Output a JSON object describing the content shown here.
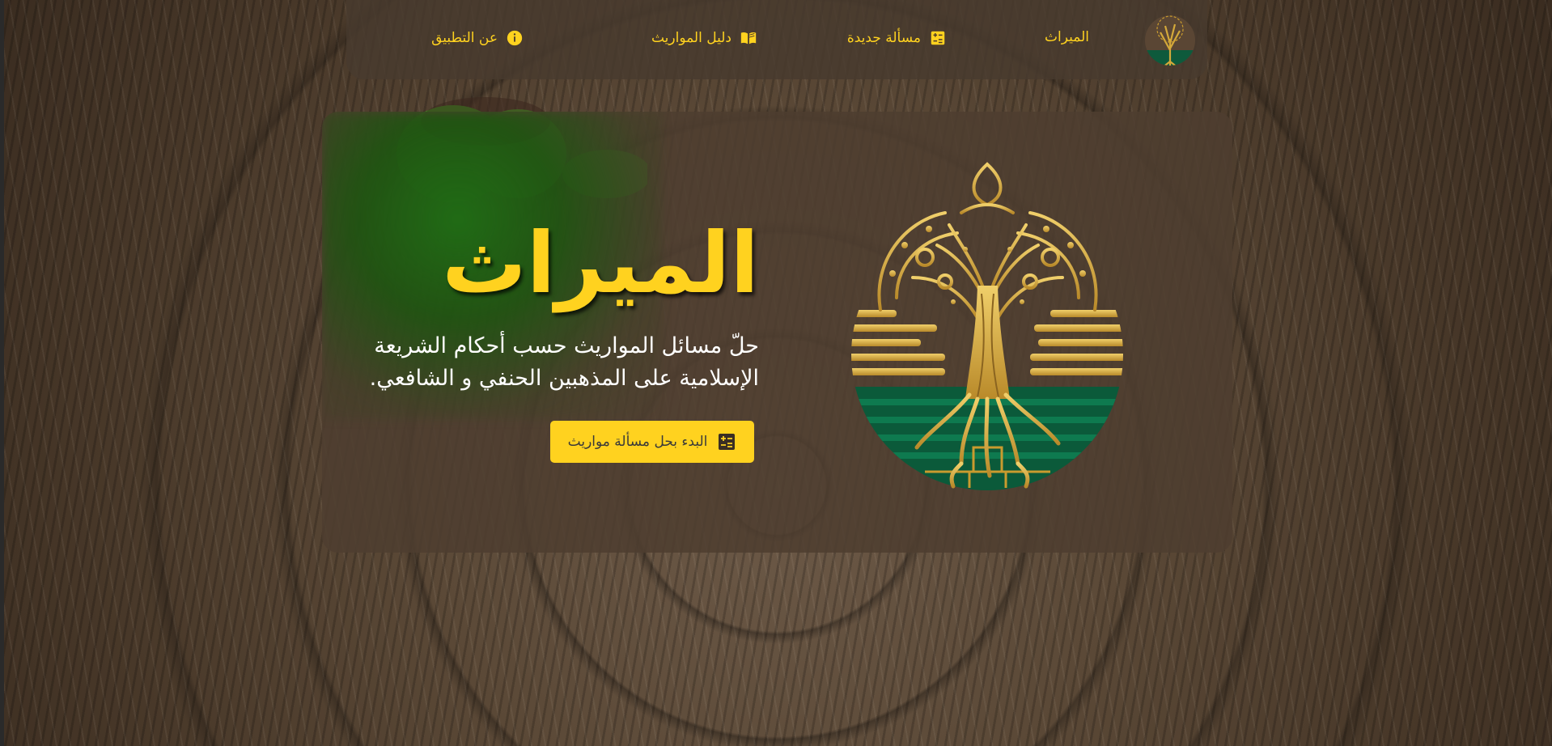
{
  "colors": {
    "accent": "#ffd21f",
    "green": "#0b5a3a",
    "card": "#4e3e30"
  },
  "nav": {
    "brand": "الميراث",
    "items": [
      {
        "label": "مسألة جديدة",
        "icon": "calculator-icon"
      },
      {
        "label": "دليل المواريث",
        "icon": "book-open-icon"
      },
      {
        "label": "عن التطبيق",
        "icon": "info-icon"
      }
    ]
  },
  "hero": {
    "title": "الميراث",
    "description": "حلّ مسائل المواريث حسب أحكام الشريعة الإسلامية على المذهبين الحنفي و الشافعي.",
    "cta": {
      "label": "البدء بحل مسألة مواريث",
      "icon": "calculator-icon"
    }
  }
}
